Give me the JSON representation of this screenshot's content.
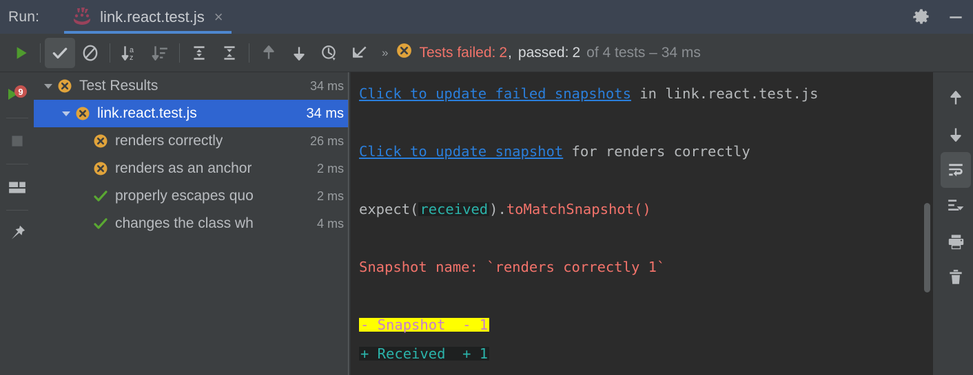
{
  "header": {
    "run_label": "Run:",
    "tab_title": "link.react.test.js",
    "close_glyph": "×",
    "settings_icon": "gear-icon",
    "minimize_icon": "minimize-icon"
  },
  "toolbar": {
    "buttons": [
      {
        "name": "rerun-tests-button",
        "icon": "play-icon"
      },
      {
        "name": "toggle-passed-tests-button",
        "icon": "check-icon",
        "active": true
      },
      {
        "name": "toggle-ignored-tests-button",
        "icon": "no-entry-icon"
      },
      {
        "name": "sort-alphabetically-button",
        "icon": "sort-alpha-icon"
      },
      {
        "name": "sort-by-duration-button",
        "icon": "sort-duration-icon"
      },
      {
        "name": "expand-all-button",
        "icon": "expand-all-icon"
      },
      {
        "name": "collapse-all-button",
        "icon": "collapse-all-icon"
      },
      {
        "name": "previous-failed-test-button",
        "icon": "arrow-up-icon"
      },
      {
        "name": "next-failed-test-button",
        "icon": "arrow-down-icon"
      },
      {
        "name": "test-history-button",
        "icon": "clock-history-icon"
      },
      {
        "name": "scroll-to-source-button",
        "icon": "jump-to-source-icon"
      }
    ],
    "overflow_glyph": "»",
    "status": {
      "icon": "failed-badge-icon",
      "failed_label": "Tests failed:",
      "failed_count": "2",
      "comma": ",",
      "passed_label": "passed:",
      "passed_count": "2",
      "suffix": "of 4 tests – 34 ms"
    }
  },
  "left_strip": {
    "buttons": [
      {
        "name": "rerun-failed-button",
        "icon": "rerun-badge-icon",
        "badge": "9"
      },
      {
        "name": "stop-button",
        "icon": "stop-square-icon"
      },
      {
        "name": "layout-settings-button",
        "icon": "layout-icon"
      },
      {
        "name": "pin-tab-button",
        "icon": "pin-icon"
      }
    ]
  },
  "tree": {
    "rows": [
      {
        "name": "tree-row-test-results",
        "label": "Test Results",
        "time": "34 ms",
        "status": "failed",
        "indent": 0,
        "expanded": true,
        "selected": false
      },
      {
        "name": "tree-row-link-react-test-js",
        "label": "link.react.test.js",
        "time": "34 ms",
        "status": "failed",
        "indent": 1,
        "expanded": true,
        "selected": true
      },
      {
        "name": "tree-row-renders-correctly",
        "label": "renders correctly",
        "time": "26 ms",
        "status": "failed",
        "indent": 2,
        "expanded": false,
        "selected": false
      },
      {
        "name": "tree-row-renders-as-an-anchor",
        "label": "renders as an anchor",
        "time": "2 ms",
        "status": "failed",
        "indent": 2,
        "expanded": false,
        "selected": false
      },
      {
        "name": "tree-row-properly-escapes-quo",
        "label": "properly escapes quo",
        "time": "2 ms",
        "status": "passed",
        "indent": 2,
        "expanded": false,
        "selected": false
      },
      {
        "name": "tree-row-changes-the-class-wh",
        "label": "changes the class wh",
        "time": "4 ms",
        "status": "passed",
        "indent": 2,
        "expanded": false,
        "selected": false
      }
    ]
  },
  "console": {
    "line1_link": "Click to update failed snapshots",
    "line1_rest": " in link.react.test.js",
    "line2_link": "Click to update snapshot",
    "line2_rest": " for renders correctly",
    "expect_pre": "expect(",
    "expect_received": "received",
    "expect_mid": ").",
    "expect_matcher": "toMatchSnapshot()",
    "snapshot_name": "Snapshot name: `renders correctly 1`",
    "diff_removed": "- Snapshot  - 1",
    "diff_added": "+ Received  + 1"
  },
  "right_strip": {
    "buttons": [
      {
        "name": "scroll-up-button",
        "icon": "arrow-up-icon"
      },
      {
        "name": "scroll-down-button",
        "icon": "arrow-down-icon"
      },
      {
        "name": "soft-wrap-button",
        "icon": "soft-wrap-icon",
        "active": true
      },
      {
        "name": "scroll-to-end-button",
        "icon": "scroll-to-end-icon"
      },
      {
        "name": "print-button",
        "icon": "printer-icon"
      },
      {
        "name": "clear-all-button",
        "icon": "trash-icon"
      }
    ]
  },
  "colors": {
    "header_bg": "#3c4451",
    "panel_bg": "#3c3f41",
    "console_bg": "#2b2b2b",
    "selection": "#2f65d1",
    "tab_underline": "#4e87cf",
    "fail_red": "#f0736a",
    "fail_orange": "#e0a33b",
    "pass_green": "#5aa832",
    "link_blue": "#2a7fdc",
    "teal": "#2bb3aa",
    "magenta": "#c77bd0",
    "highlight_yellow": "#ffff00"
  }
}
